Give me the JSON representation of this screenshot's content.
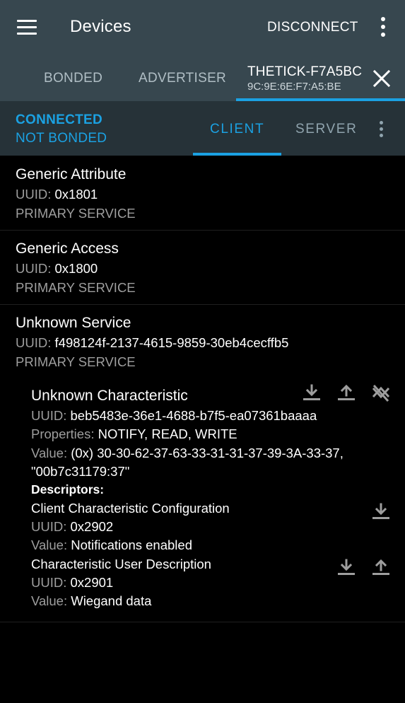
{
  "appbar": {
    "title": "Devices",
    "disconnect_label": "DISCONNECT"
  },
  "tabs": {
    "bonded": "BONDED",
    "advertiser": "ADVERTISER",
    "device_name": "THETICK-F7A5BC",
    "device_address": "9C:9E:6E:F7:A5:BE"
  },
  "status": {
    "connection": "CONNECTED",
    "bond": "NOT BONDED",
    "client_tab": "CLIENT",
    "server_tab": "SERVER"
  },
  "services": [
    {
      "name": "Generic Attribute",
      "uuid_label": "UUID:",
      "uuid": "0x1801",
      "type": "PRIMARY SERVICE"
    },
    {
      "name": "Generic Access",
      "uuid_label": "UUID:",
      "uuid": "0x1800",
      "type": "PRIMARY SERVICE"
    },
    {
      "name": "Unknown Service",
      "uuid_label": "UUID:",
      "uuid": "f498124f-2137-4615-9859-30eb4cecffb5",
      "type": "PRIMARY SERVICE"
    }
  ],
  "characteristic": {
    "name": "Unknown Characteristic",
    "uuid_label": "UUID:",
    "uuid": "beb5483e-36e1-4688-b7f5-ea07361baaaa",
    "properties_label": "Properties:",
    "properties": "NOTIFY, READ, WRITE",
    "value_label": "Value:",
    "value_line1": "(0x) 30-30-62-37-63-33-31-31-37-39-3A-33-37,",
    "value_line2": "\"00b7c31179:37\"",
    "descriptors_label": "Descriptors:",
    "descriptors": [
      {
        "name": "Client Characteristic Configuration",
        "uuid_label": "UUID:",
        "uuid": "0x2902",
        "value_label": "Value:",
        "value": "Notifications enabled"
      },
      {
        "name": "Characteristic User Description",
        "uuid_label": "UUID:",
        "uuid": "0x2901",
        "value_label": "Value:",
        "value": "Wiegand data"
      }
    ]
  },
  "colors": {
    "appbar": "#37474f",
    "statusbar": "#263238",
    "accent": "#1ba1e2",
    "background": "#000000"
  },
  "icons": [
    "menu-icon",
    "more-vert-icon",
    "close-icon",
    "download-icon",
    "upload-icon",
    "notifications-off-icon"
  ]
}
